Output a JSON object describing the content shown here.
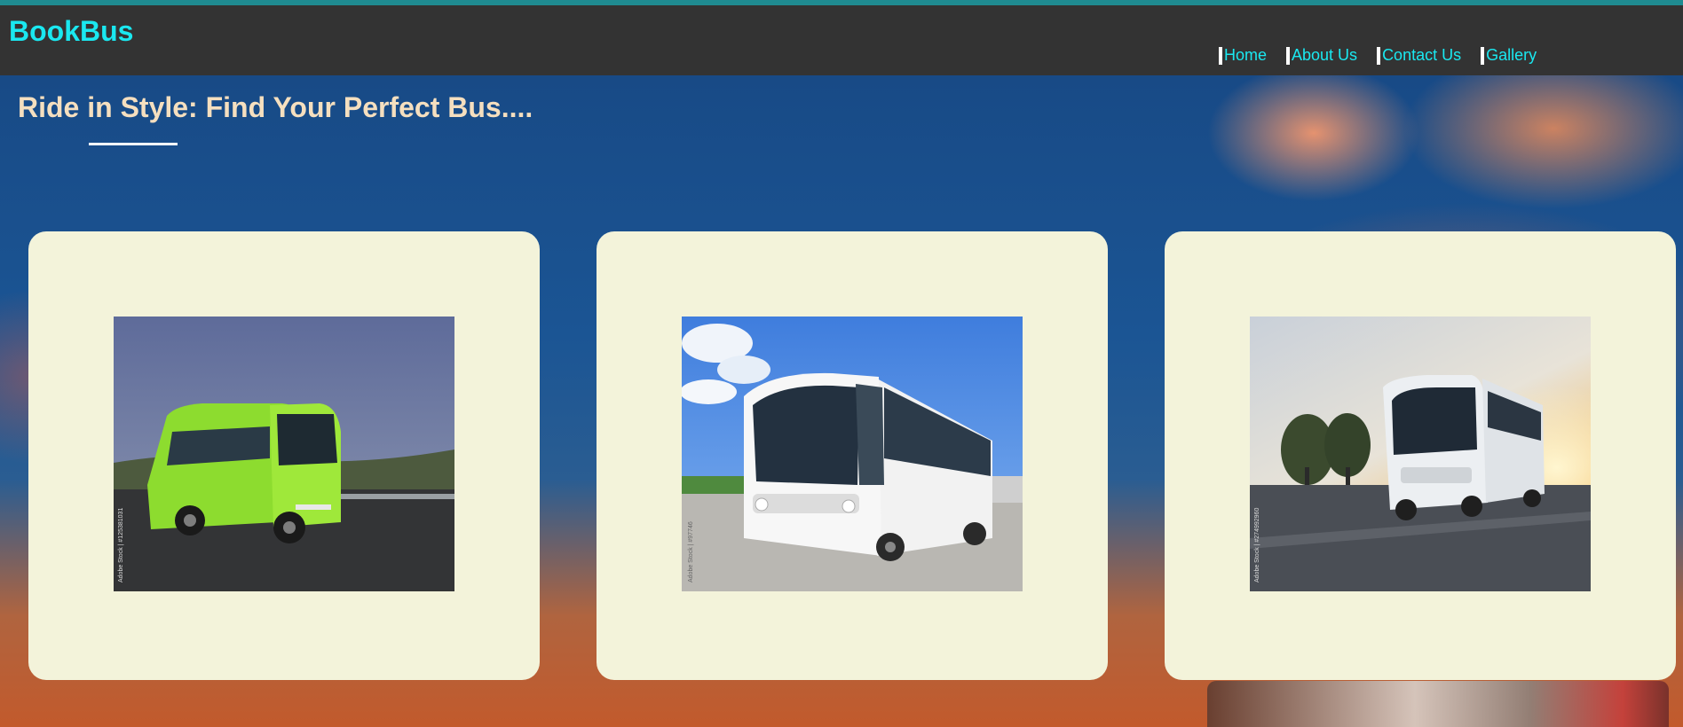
{
  "header": {
    "logo": "BookBus",
    "nav": [
      {
        "label": "Home"
      },
      {
        "label": "About Us"
      },
      {
        "label": "Contact Us"
      },
      {
        "label": "Gallery"
      }
    ]
  },
  "hero": {
    "headline": "Ride in Style: Find Your Perfect Bus...."
  },
  "cards": [
    {
      "image": "green-bus-photo",
      "watermark": "Adobe Stock | #125381031"
    },
    {
      "image": "white-bus-photo",
      "watermark": "Adobe Stock | #97746"
    },
    {
      "image": "sunset-bus-photo",
      "watermark": "Adobe Stock | #274992960"
    }
  ],
  "colors": {
    "accent": "#1ae8f0",
    "navbar": "#333333",
    "headline": "#f5dfbf",
    "card": "#f3f3da"
  }
}
